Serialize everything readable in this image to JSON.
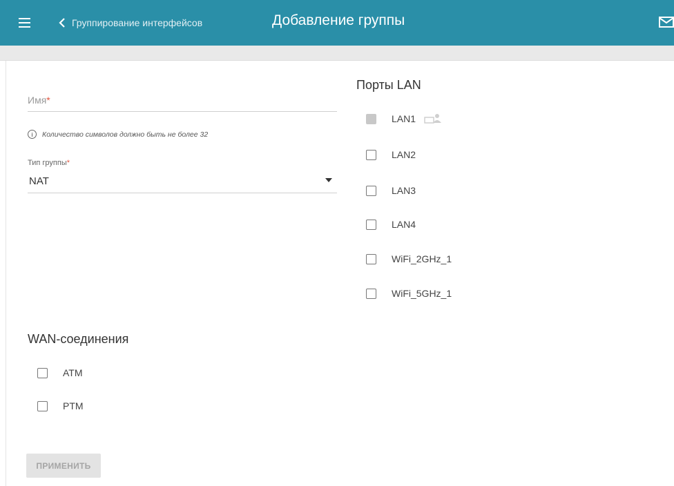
{
  "header": {
    "back_label": "Группирование интерфейсов",
    "title": "Добавление группы",
    "bg_color": "#2a8fa8"
  },
  "form": {
    "name_label": "Имя",
    "required_mark": "*",
    "hint": "Количество символов должно быть не более 32",
    "group_type_label": "Тип группы",
    "group_type_value": "NAT"
  },
  "lan": {
    "title": "Порты LAN",
    "ports": [
      {
        "label": "LAN1",
        "checked": false,
        "disabled": true
      },
      {
        "label": "LAN2",
        "checked": false
      },
      {
        "label": "LAN3",
        "checked": false
      },
      {
        "label": "LAN4",
        "checked": false
      },
      {
        "label": "WiFi_2GHz_1",
        "checked": false
      },
      {
        "label": "WiFi_5GHz_1",
        "checked": false
      }
    ]
  },
  "wan": {
    "title": "WAN-соединения",
    "connections": [
      {
        "label": "ATM",
        "checked": false
      },
      {
        "label": "PTM",
        "checked": false
      }
    ]
  },
  "actions": {
    "apply_label": "ПРИМЕНИТЬ"
  },
  "icons": {
    "menu": "hamburger-menu-icon",
    "back": "chevron-left-icon",
    "mail": "mail-icon",
    "info": "info-icon",
    "caret": "caret-down-icon",
    "user": "user-icon"
  }
}
